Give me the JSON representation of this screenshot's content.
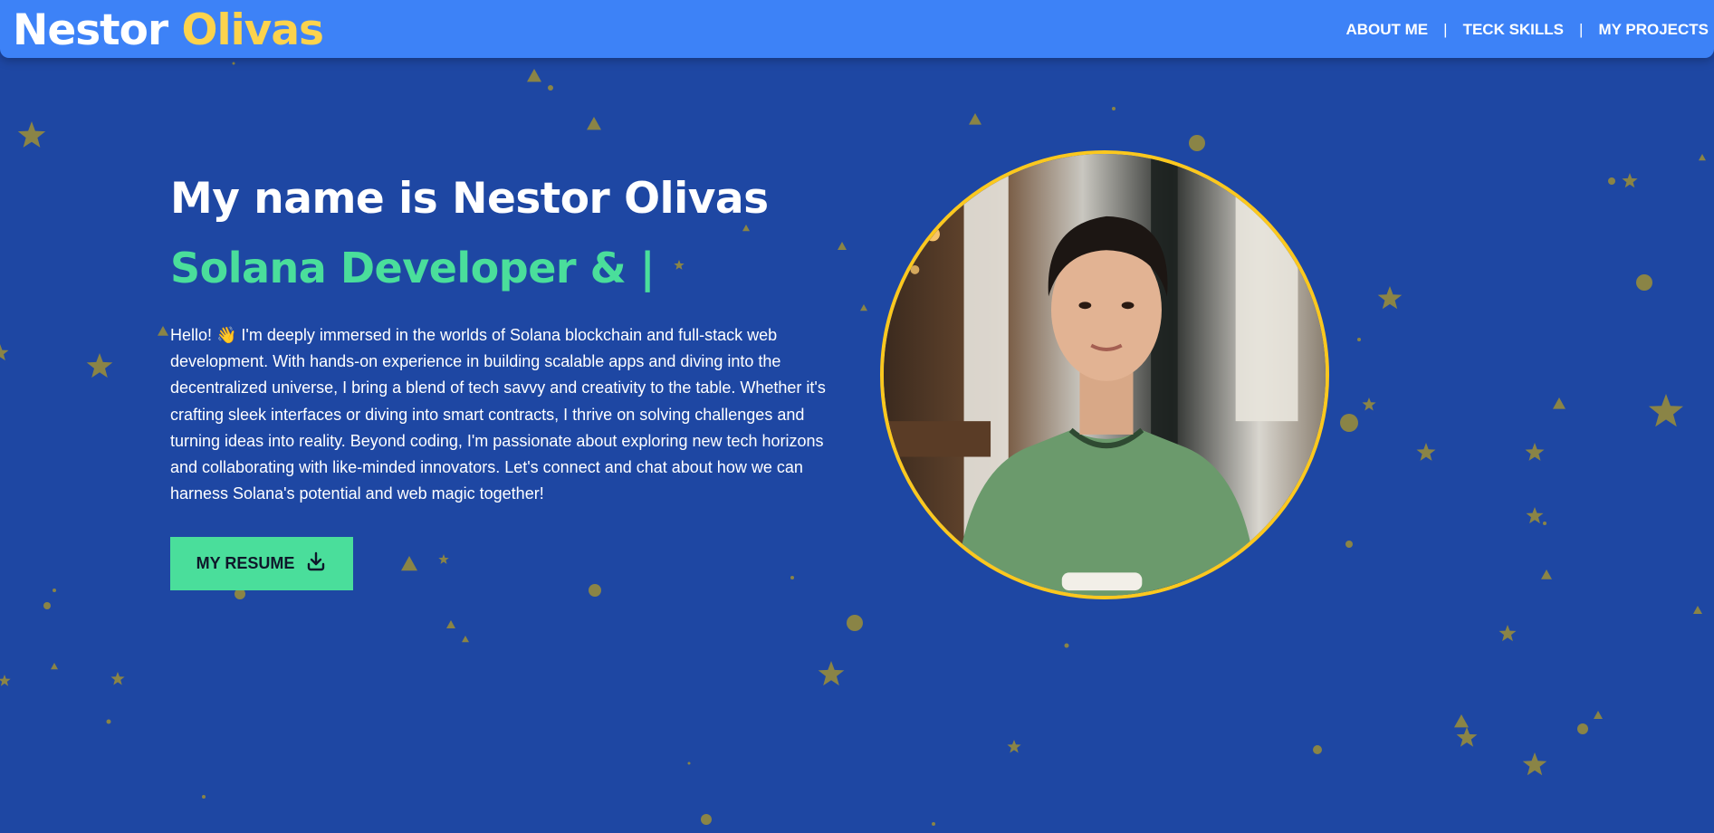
{
  "brand": {
    "first": "Nestor",
    "last": "Olivas"
  },
  "nav": {
    "items": [
      "ABOUT ME",
      "TECK SKILLS",
      "MY PROJECTS"
    ],
    "separator": "|"
  },
  "hero": {
    "title": "My name is Nestor Olivas",
    "role": "Solana Developer & |",
    "intro": "Hello! 👋 I'm deeply immersed in the worlds of Solana blockchain and full-stack web development. With hands-on experience in building scalable apps and diving into the decentralized universe, I bring a blend of tech savvy and creativity to the table. Whether it's crafting sleek interfaces or diving into smart contracts, I thrive on solving challenges and turning ideas into reality. Beyond coding, I'm passionate about exploring new tech horizons and collaborating with like-minded innovators. Let's connect and chat about how we can harness Solana's potential and web magic together!",
    "resume_label": "MY RESUME",
    "resume_icon": "download-icon"
  },
  "colors": {
    "background": "#1e47a3",
    "navbar": "#3d82f7",
    "accent_yellow": "#fcd34d",
    "accent_green": "#4ade9b",
    "particles": "#8a8446"
  }
}
